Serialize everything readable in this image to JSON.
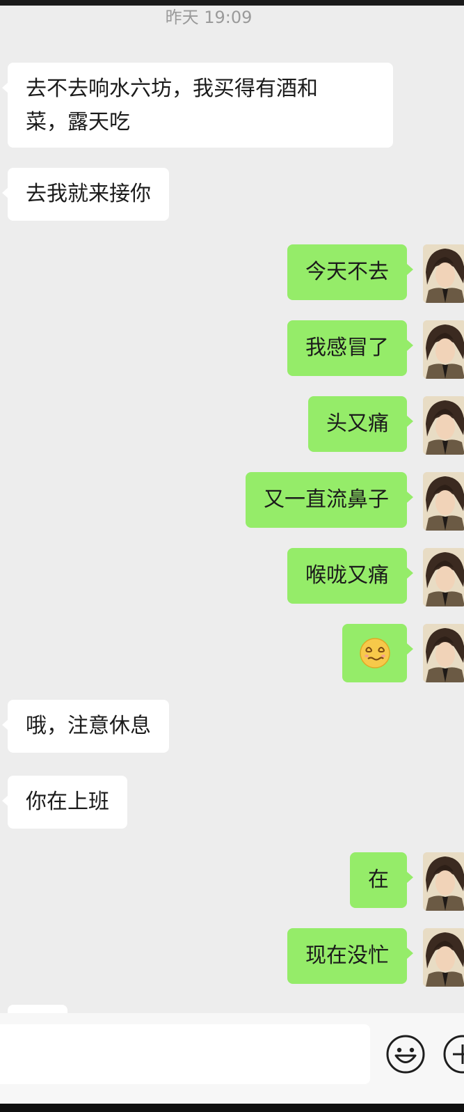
{
  "chat": {
    "timestamp": "昨天 19:09",
    "messages": [
      {
        "side": "left",
        "text_lines": [
          "去不去响水六坊，我买得有酒和",
          "菜，露天吃"
        ]
      },
      {
        "side": "left",
        "text": "去我就来接你"
      },
      {
        "side": "right",
        "text": "今天不去"
      },
      {
        "side": "right",
        "text": "我感冒了"
      },
      {
        "side": "right",
        "text": "头又痛"
      },
      {
        "side": "right",
        "text": "又一直流鼻子"
      },
      {
        "side": "right",
        "text": "喉咙又痛"
      },
      {
        "side": "right",
        "emoji": "dizzy-face-emoji"
      },
      {
        "side": "left",
        "text": "哦，注意休息"
      },
      {
        "side": "left",
        "text": "你在上班"
      },
      {
        "side": "right",
        "text": "在"
      },
      {
        "side": "right",
        "text": "现在没忙"
      }
    ]
  },
  "input_bar": {
    "value": "",
    "emoji_icon": "smiley-icon",
    "plus_icon": "plus-circle-icon"
  },
  "colors": {
    "background": "#ededed",
    "outgoing_bubble": "#95ec69",
    "incoming_bubble": "#ffffff",
    "timestamp": "#9a9a9a"
  }
}
